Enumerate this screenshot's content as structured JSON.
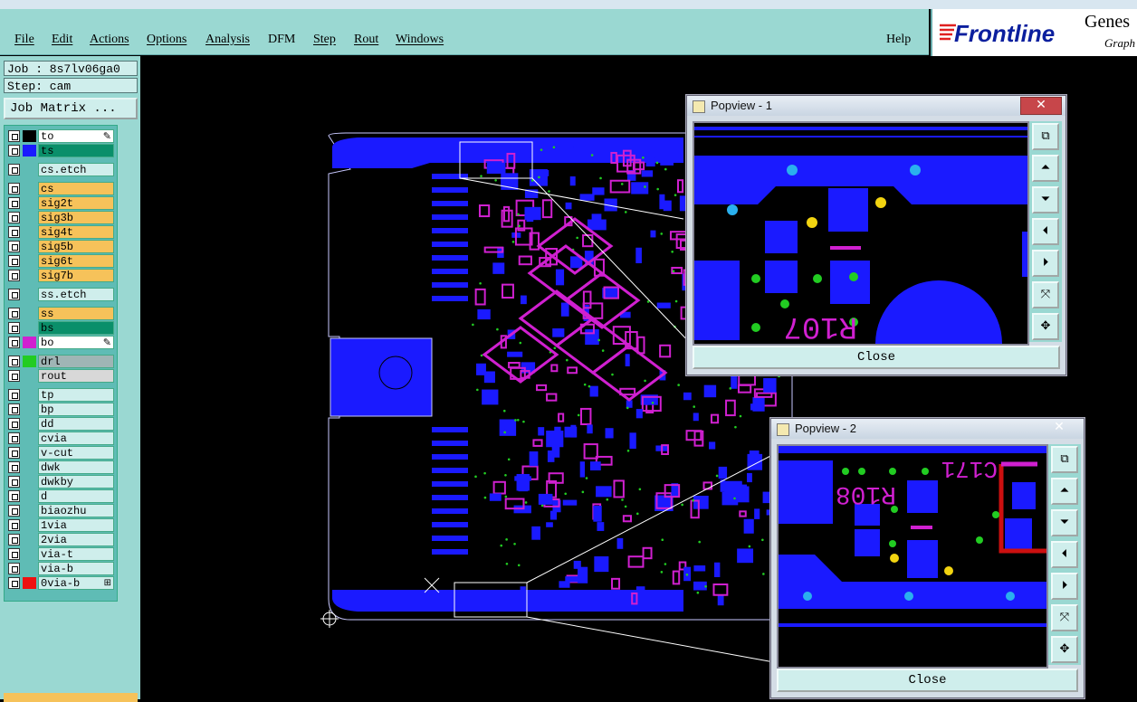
{
  "menubar": {
    "items": [
      "File",
      "Edit",
      "Actions",
      "Options",
      "Analysis",
      "DFM",
      "Step",
      "Rout",
      "Windows"
    ],
    "help": "Help"
  },
  "logo": {
    "brand": "Frontline",
    "side": "Genes",
    "sub": "Graph"
  },
  "job": {
    "job_line": "Job : 8s7lv06ga0",
    "step_line": "Step: cam",
    "matrix_button": "Job Matrix ..."
  },
  "layers": [
    {
      "name": "to",
      "color": "#000000",
      "bg": "#ffffff",
      "marker": "pen"
    },
    {
      "name": "ts",
      "color": "#1a1aff",
      "bg": "#0a8f6a",
      "marker": ""
    },
    {
      "name": "cs.etch",
      "color": "#5fbcb5",
      "bg": "#cfeeec",
      "marker": ""
    },
    {
      "name": "cs",
      "color": "#5fbcb5",
      "bg": "#f6c25a",
      "marker": ""
    },
    {
      "name": "sig2t",
      "color": "#5fbcb5",
      "bg": "#f6c25a",
      "marker": ""
    },
    {
      "name": "sig3b",
      "color": "#5fbcb5",
      "bg": "#f6c25a",
      "marker": ""
    },
    {
      "name": "sig4t",
      "color": "#5fbcb5",
      "bg": "#f6c25a",
      "marker": ""
    },
    {
      "name": "sig5b",
      "color": "#5fbcb5",
      "bg": "#f6c25a",
      "marker": ""
    },
    {
      "name": "sig6t",
      "color": "#5fbcb5",
      "bg": "#f6c25a",
      "marker": ""
    },
    {
      "name": "sig7b",
      "color": "#5fbcb5",
      "bg": "#f6c25a",
      "marker": ""
    },
    {
      "name": "ss.etch",
      "color": "#5fbcb5",
      "bg": "#cfeeec",
      "marker": ""
    },
    {
      "name": "ss",
      "color": "#5fbcb5",
      "bg": "#f6c25a",
      "marker": ""
    },
    {
      "name": "bs",
      "color": "#5fbcb5",
      "bg": "#0a8f6a",
      "marker": ""
    },
    {
      "name": "bo",
      "color": "#d020d0",
      "bg": "#ffffff",
      "marker": "pen"
    },
    {
      "name": "drl",
      "color": "#22cc22",
      "bg": "#9fb5b5",
      "marker": ""
    },
    {
      "name": "rout",
      "color": "#5fbcb5",
      "bg": "#d8d8d8",
      "marker": ""
    },
    {
      "name": "tp",
      "color": "#5fbcb5",
      "bg": "#cfeeec",
      "marker": ""
    },
    {
      "name": "bp",
      "color": "#5fbcb5",
      "bg": "#cfeeec",
      "marker": ""
    },
    {
      "name": "dd",
      "color": "#5fbcb5",
      "bg": "#cfeeec",
      "marker": ""
    },
    {
      "name": "cvia",
      "color": "#5fbcb5",
      "bg": "#cfeeec",
      "marker": ""
    },
    {
      "name": "v-cut",
      "color": "#5fbcb5",
      "bg": "#cfeeec",
      "marker": ""
    },
    {
      "name": "dwk",
      "color": "#5fbcb5",
      "bg": "#cfeeec",
      "marker": ""
    },
    {
      "name": "dwkby",
      "color": "#5fbcb5",
      "bg": "#cfeeec",
      "marker": ""
    },
    {
      "name": "d",
      "color": "#5fbcb5",
      "bg": "#cfeeec",
      "marker": ""
    },
    {
      "name": "biaozhu",
      "color": "#5fbcb5",
      "bg": "#cfeeec",
      "marker": ""
    },
    {
      "name": "1via",
      "color": "#5fbcb5",
      "bg": "#cfeeec",
      "marker": ""
    },
    {
      "name": "2via",
      "color": "#5fbcb5",
      "bg": "#cfeeec",
      "marker": ""
    },
    {
      "name": "via-t",
      "color": "#5fbcb5",
      "bg": "#cfeeec",
      "marker": ""
    },
    {
      "name": "via-b",
      "color": "#5fbcb5",
      "bg": "#cfeeec",
      "marker": ""
    },
    {
      "name": "0via-b",
      "color": "#ee1111",
      "bg": "#cfeeec",
      "marker": "grid"
    }
  ],
  "bottom_label": "",
  "popview1": {
    "title": "Popview - 1",
    "close_label": "Close",
    "close_x": "✕"
  },
  "popview2": {
    "title": "Popview - 2",
    "close_label": "Close",
    "close_x": "✕"
  },
  "pv_tools": [
    "zoom-fit",
    "pan-up",
    "pan-down",
    "pan-left",
    "pan-right",
    "zoom-out",
    "zoom-in"
  ],
  "colors": {
    "panel": "#9ad8d2",
    "copper": "#1a1aff",
    "silk": "#d020d0",
    "drill_green": "#22cc22"
  }
}
